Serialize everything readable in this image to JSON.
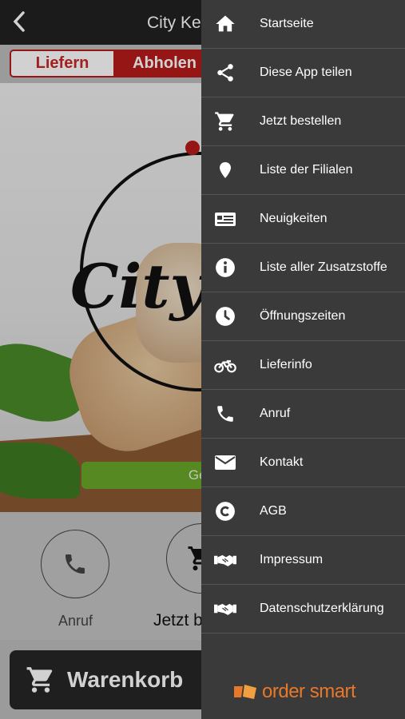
{
  "app": {
    "title": "City Keb",
    "order_mode": {
      "deliver_label": "Liefern",
      "pickup_label": "Abholen"
    },
    "hero": {
      "logo_text": "City K",
      "geo_button_label": "Geö"
    },
    "actions": {
      "call_label": "Anruf",
      "order_label": "Jetzt b"
    },
    "cart_label": "Warenkorb"
  },
  "drawer": {
    "items": [
      {
        "label": "Startseite",
        "icon": "home-icon"
      },
      {
        "label": "Diese App teilen",
        "icon": "share-icon"
      },
      {
        "label": "Jetzt bestellen",
        "icon": "cart-icon"
      },
      {
        "label": "Liste der Filialen",
        "icon": "map-pin-icon"
      },
      {
        "label": "Neuigkeiten",
        "icon": "news-icon"
      },
      {
        "label": "Liste aller Zusatzstoffe",
        "icon": "info-icon"
      },
      {
        "label": "Öffnungszeiten",
        "icon": "clock-icon"
      },
      {
        "label": "Lieferinfo",
        "icon": "motorcycle-icon"
      },
      {
        "label": "Anruf",
        "icon": "phone-icon"
      },
      {
        "label": "Kontakt",
        "icon": "envelope-icon"
      },
      {
        "label": "AGB",
        "icon": "copyright-icon"
      },
      {
        "label": "Impressum",
        "icon": "handshake-icon"
      },
      {
        "label": "Datenschutzerklärung",
        "icon": "handshake-icon"
      }
    ],
    "brand": "order smart"
  },
  "colors": {
    "accent_red": "#b71c1c",
    "drawer_bg": "#3a3a3a",
    "brand_orange": "#e8782a",
    "geo_green": "#6aa82a"
  }
}
